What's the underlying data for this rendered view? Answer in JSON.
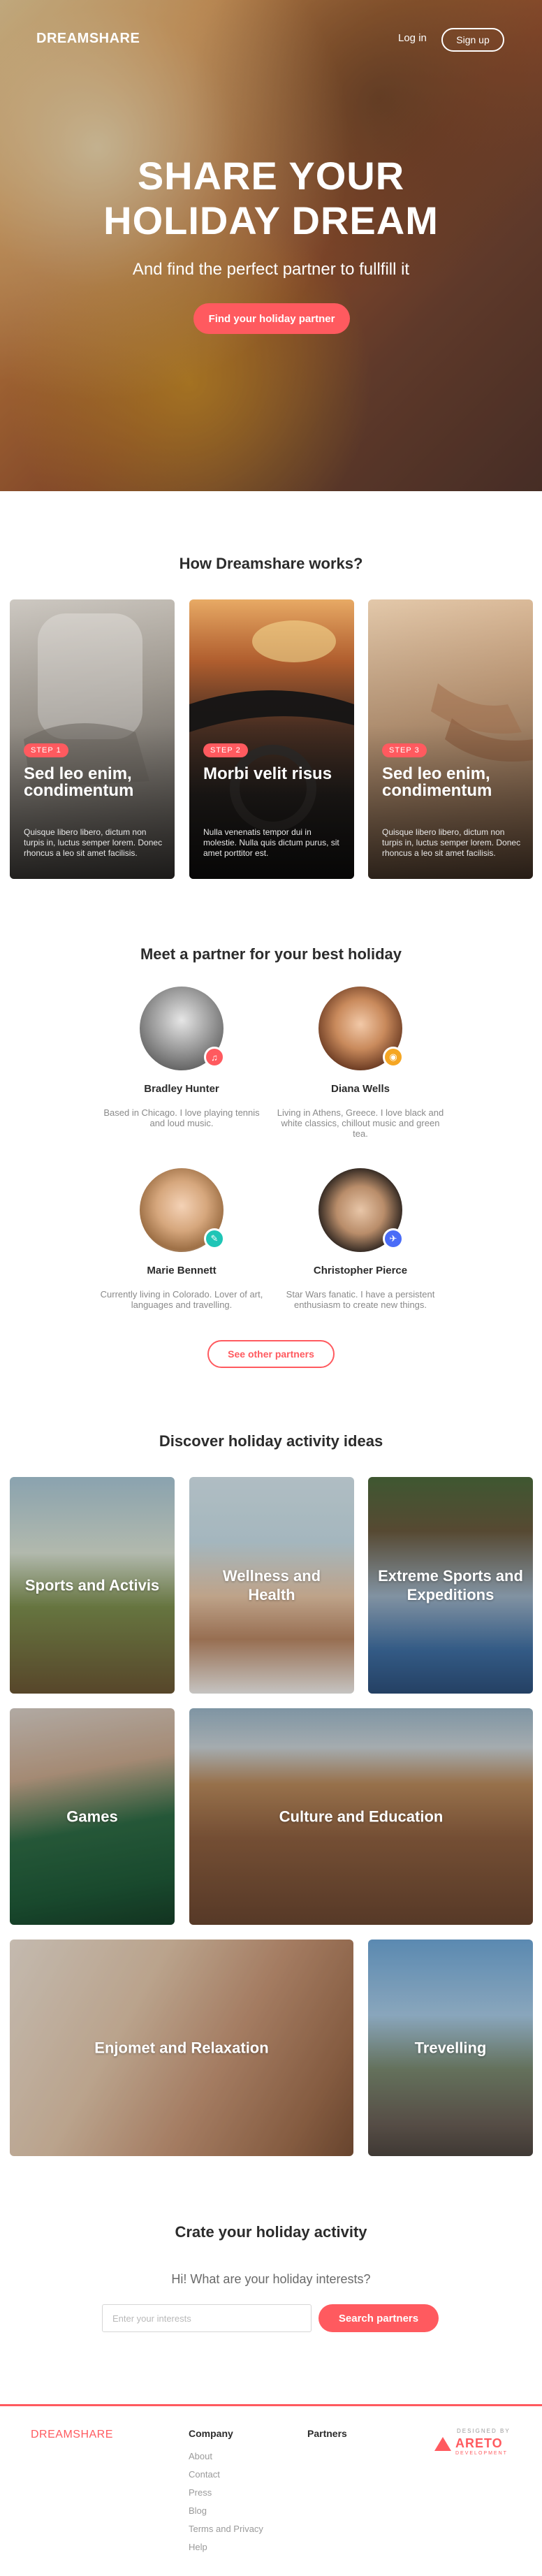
{
  "header": {
    "logo": "DREAMSHARE",
    "login": "Log in",
    "signup": "Sign up"
  },
  "hero": {
    "title_line1": "SHARE YOUR",
    "title_line2": "HOLIDAY DREAM",
    "subtitle": "And find the perfect partner to fullfill it",
    "cta": "Find your holiday partner"
  },
  "how": {
    "title": "How Dreamshare works?",
    "steps": [
      {
        "badge": "STEP 1",
        "title": "Sed leo enim, condimentum",
        "text": "Quisque libero libero, dictum non turpis in, luctus semper lorem. Donec rhoncus a leo sit amet facilisis."
      },
      {
        "badge": "STEP 2",
        "title": "Morbi velit risus",
        "text": "Nulla venenatis tempor dui in molestie. Nulla quis dictum purus, sit amet porttitor est."
      },
      {
        "badge": "STEP 3",
        "title": "Sed leo enim, condimentum",
        "text": "Quisque libero libero, dictum non turpis in, luctus semper lorem. Donec rhoncus a leo sit amet facilisis."
      }
    ]
  },
  "partners": {
    "title": "Meet a partner for your best holiday",
    "people": [
      {
        "name": "Bradley Hunter",
        "desc": "Based in Chicago. I love playing tennis and loud music.",
        "icon": "music-note-icon"
      },
      {
        "name": "Diana Wells",
        "desc": "Living in Athens, Greece. I love black and white classics, chillout music and green tea.",
        "icon": "camera-icon"
      },
      {
        "name": "Marie Bennett",
        "desc": "Currently living in Colorado. Lover of art, languages and travelling.",
        "icon": "pencil-icon"
      },
      {
        "name": "Christopher Pierce",
        "desc": "Star Wars fanatic. I have a persistent enthusiasm to create new things.",
        "icon": "airplane-icon"
      }
    ],
    "see_other": "See other partners"
  },
  "activities": {
    "title": "Discover holiday activity ideas",
    "items": [
      {
        "label": "Sports and Activis"
      },
      {
        "label": "Wellness and Health"
      },
      {
        "label": "Extreme Sports and Expeditions"
      },
      {
        "label": "Games"
      },
      {
        "label": "Culture and Education"
      },
      {
        "label": "Enjomet and Relaxation"
      },
      {
        "label": "Trevelling"
      }
    ]
  },
  "create": {
    "title": "Crate your holiday activity",
    "subtitle": "Hi! What are your holiday interests?",
    "placeholder": "Enter your interests",
    "button": "Search partners"
  },
  "footer": {
    "logo": "DREAMSHARE",
    "company_title": "Company",
    "company_links": [
      "About",
      "Contact",
      "Press",
      "Blog",
      "Terms and Privacy",
      "Help"
    ],
    "partners_title": "Partners",
    "designed_by": "DESIGNED BY",
    "brand": "ARETO",
    "brand_sub": "DEVELOPMENT"
  },
  "colors": {
    "accent": "#ff5a5f",
    "heading": "#2c2c2c",
    "muted": "#8a8a8a"
  }
}
